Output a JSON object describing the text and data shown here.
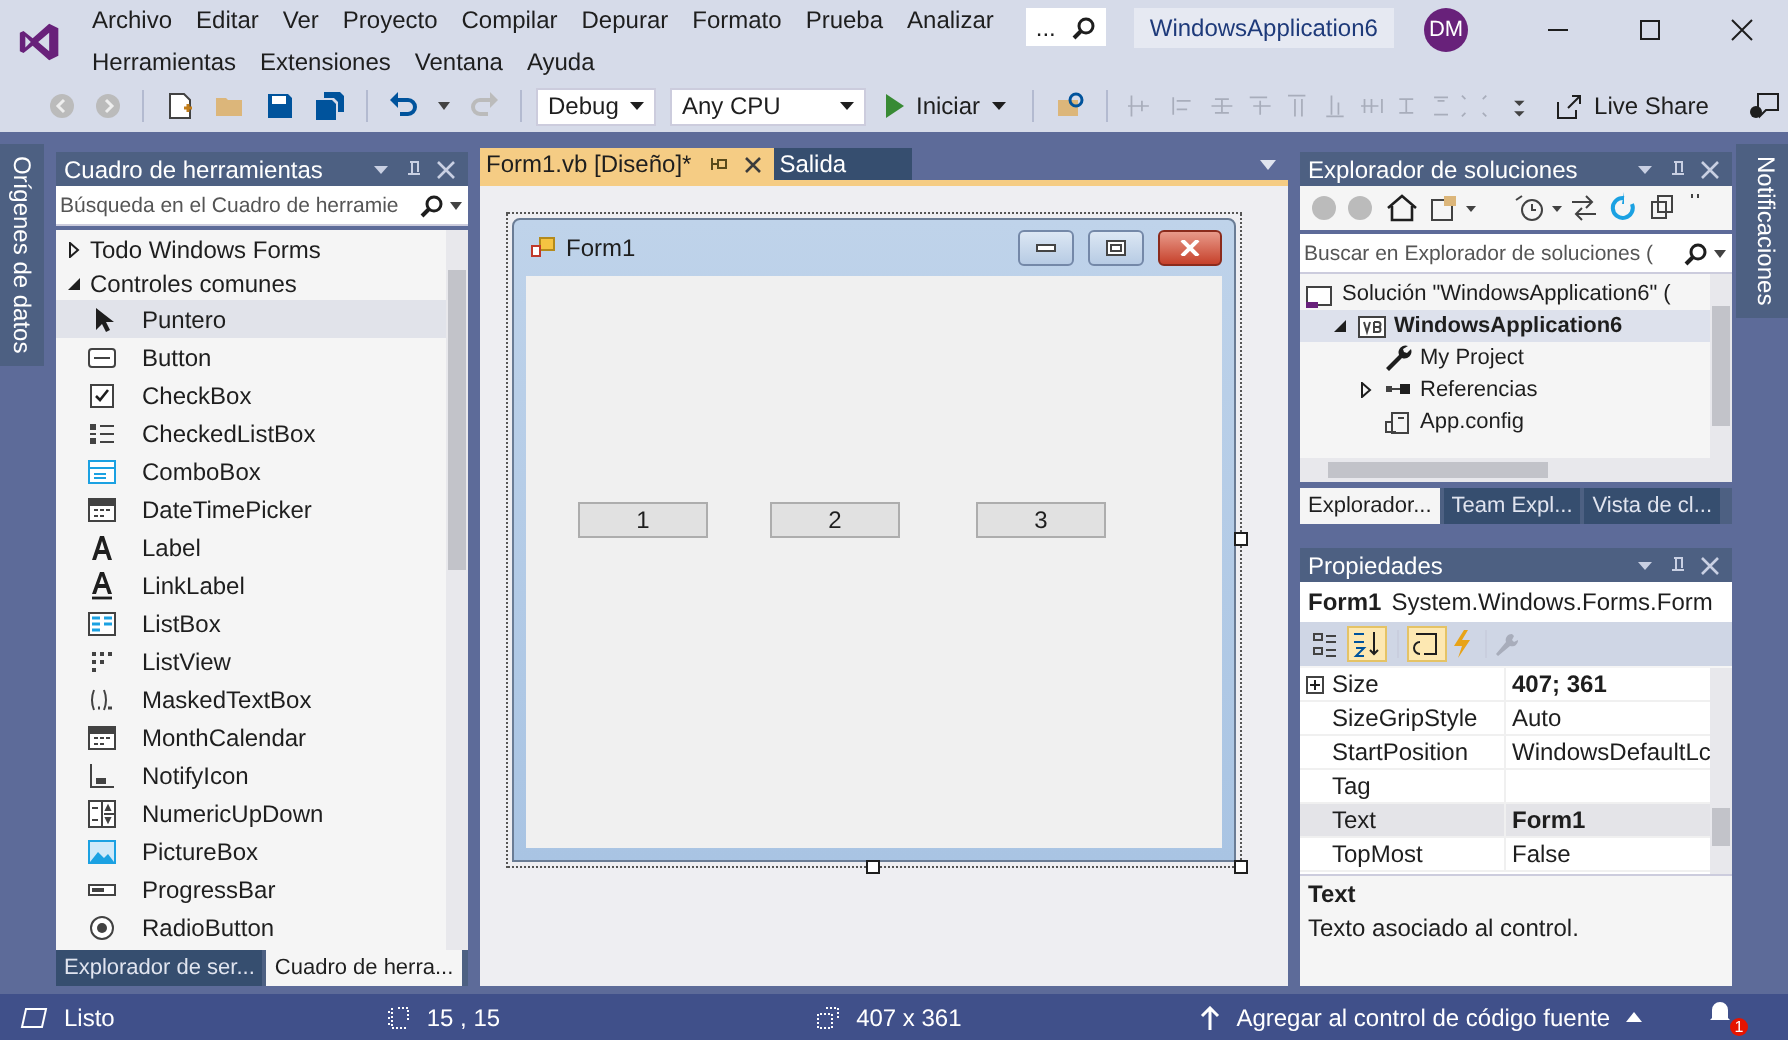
{
  "title_bar": {
    "menu_row_1": [
      "Archivo",
      "Editar",
      "Ver",
      "Proyecto",
      "Compilar",
      "Depurar",
      "Formato",
      "Prueba",
      "Analizar"
    ],
    "menu_row_2": [
      "Herramientas",
      "Extensiones",
      "Ventana",
      "Ayuda"
    ],
    "search": {
      "value": "..."
    },
    "project": "WindowsApplication6",
    "user_initials": "DM"
  },
  "toolbar": {
    "configuration": "Debug",
    "platform": "Any CPU",
    "start": "Iniciar",
    "live_share": "Live Share"
  },
  "left_tabs": [
    "Orígenes de datos"
  ],
  "toolbox": {
    "title": "Cuadro de herramientas",
    "search": {
      "placeholder": "Búsqueda en el Cuadro de herramie"
    },
    "groups": [
      {
        "label": "Todo Windows Forms",
        "expanded": false
      },
      {
        "label": "Controles comunes",
        "expanded": true
      }
    ],
    "items": [
      {
        "label": "Puntero",
        "kind": "pointer",
        "selected": true
      },
      {
        "label": "Button",
        "kind": "button",
        "selected": false
      },
      {
        "label": "CheckBox",
        "kind": "checkbox",
        "selected": false
      },
      {
        "label": "CheckedListBox",
        "kind": "checklist",
        "selected": false
      },
      {
        "label": "ComboBox",
        "kind": "combo",
        "selected": false
      },
      {
        "label": "DateTimePicker",
        "kind": "calendar",
        "selected": false
      },
      {
        "label": "Label",
        "kind": "label",
        "selected": false
      },
      {
        "label": "LinkLabel",
        "kind": "linklabel",
        "selected": false
      },
      {
        "label": "ListBox",
        "kind": "listbox",
        "selected": false
      },
      {
        "label": "ListView",
        "kind": "listview",
        "selected": false
      },
      {
        "label": "MaskedTextBox",
        "kind": "masked",
        "selected": false
      },
      {
        "label": "MonthCalendar",
        "kind": "calendar",
        "selected": false
      },
      {
        "label": "NotifyIcon",
        "kind": "notify",
        "selected": false
      },
      {
        "label": "NumericUpDown",
        "kind": "numeric",
        "selected": false
      },
      {
        "label": "PictureBox",
        "kind": "picture",
        "selected": false
      },
      {
        "label": "ProgressBar",
        "kind": "progress",
        "selected": false
      },
      {
        "label": "RadioButton",
        "kind": "radio",
        "selected": false
      }
    ],
    "bottom_tabs": [
      {
        "label": "Explorador de ser...",
        "selected": false
      },
      {
        "label": "Cuadro de herra...",
        "selected": true
      }
    ]
  },
  "document": {
    "tabs": [
      {
        "label": "Form1.vb [Diseño]*",
        "selected": true
      },
      {
        "label": "Salida",
        "selected": false
      }
    ],
    "form": {
      "title": "Form1",
      "buttons": [
        "1",
        "2",
        "3"
      ]
    }
  },
  "solution_explorer": {
    "title": "Explorador de soluciones",
    "search": {
      "placeholder": "Buscar en Explorador de soluciones ("
    },
    "tree": [
      {
        "label": "Solución \"WindowsApplication6\" (",
        "kind": "solution",
        "bold": false,
        "selected": false,
        "children": [
          {
            "label": "WindowsApplication6",
            "kind": "vb",
            "bold": true,
            "selected": true,
            "expanded": true,
            "children": [
              {
                "label": "My Project",
                "kind": "wrench",
                "bold": false,
                "selected": false
              },
              {
                "label": "Referencias",
                "kind": "refs",
                "bold": false,
                "selected": false,
                "expanded": false
              },
              {
                "label": "App.config",
                "kind": "config",
                "bold": false,
                "selected": false
              }
            ]
          }
        ]
      }
    ],
    "tabs": [
      {
        "label": "Explorador...",
        "selected": true
      },
      {
        "label": "Team Expl...",
        "selected": false
      },
      {
        "label": "Vista de cl...",
        "selected": false
      }
    ]
  },
  "properties": {
    "title": "Propiedades",
    "object_name": "Form1",
    "object_type": "System.Windows.Forms.Form",
    "rows": [
      {
        "name": "Size",
        "value": "407; 361",
        "expandable": true,
        "modified": true,
        "selected": false
      },
      {
        "name": "SizeGripStyle",
        "value": "Auto",
        "expandable": false,
        "modified": false,
        "selected": false
      },
      {
        "name": "StartPosition",
        "value": "WindowsDefaultLc",
        "expandable": false,
        "modified": false,
        "selected": false
      },
      {
        "name": "Tag",
        "expandable": false,
        "modified": false,
        "selected": false
      },
      {
        "name": "Text",
        "value": "Form1",
        "expandable": false,
        "modified": true,
        "selected": true
      },
      {
        "name": "TopMost",
        "value": "False",
        "expandable": false,
        "modified": false,
        "selected": false
      }
    ],
    "description": {
      "title": "Text",
      "text": "Texto asociado al control."
    }
  },
  "right_tabs": [
    "Notificaciones"
  ],
  "status_bar": {
    "status": "Listo",
    "position": "15 , 15",
    "size": "407 x 361",
    "source_control": "Agregar al control de código fuente",
    "notifications": "1"
  }
}
